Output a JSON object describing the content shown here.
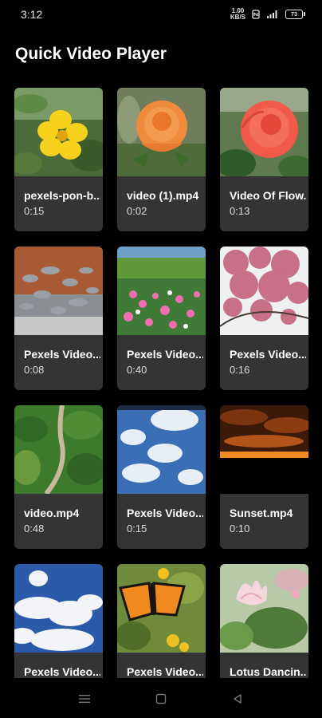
{
  "status": {
    "time": "3:12",
    "net_speed_value": "1.00",
    "net_speed_unit": "KB/S",
    "battery": "73"
  },
  "app": {
    "title": "Quick Video Player"
  },
  "videos": [
    {
      "title": "pexels-pon-b...",
      "duration": "0:15"
    },
    {
      "title": "video (1).mp4",
      "duration": "0:02"
    },
    {
      "title": "Video Of Flow...",
      "duration": "0:13"
    },
    {
      "title": "Pexels Video...",
      "duration": "0:08"
    },
    {
      "title": "Pexels Video...",
      "duration": "0:40"
    },
    {
      "title": "Pexels Video...",
      "duration": "0:16"
    },
    {
      "title": "video.mp4",
      "duration": "0:48"
    },
    {
      "title": "Pexels Video...",
      "duration": "0:15"
    },
    {
      "title": "Sunset.mp4",
      "duration": "0:10"
    },
    {
      "title": "Pexels Video...",
      "duration": ""
    },
    {
      "title": "Pexels Video...",
      "duration": ""
    },
    {
      "title": "Lotus Dancin...",
      "duration": ""
    }
  ],
  "thumb_icons": [
    "yellow-flower-thumbnail",
    "orange-rose-thumbnail",
    "red-rose-thumbnail",
    "pigeons-thumbnail",
    "flower-meadow-thumbnail",
    "cherry-blossom-thumbnail",
    "aerial-forest-road-thumbnail",
    "earth-clouds-thumbnail",
    "sunset-thumbnail",
    "sky-clouds-thumbnail",
    "butterfly-thumbnail",
    "lotus-thumbnail"
  ],
  "nav": {
    "recents_icon": "menu-icon",
    "home_icon": "square-icon",
    "back_icon": "triangle-back-icon"
  }
}
